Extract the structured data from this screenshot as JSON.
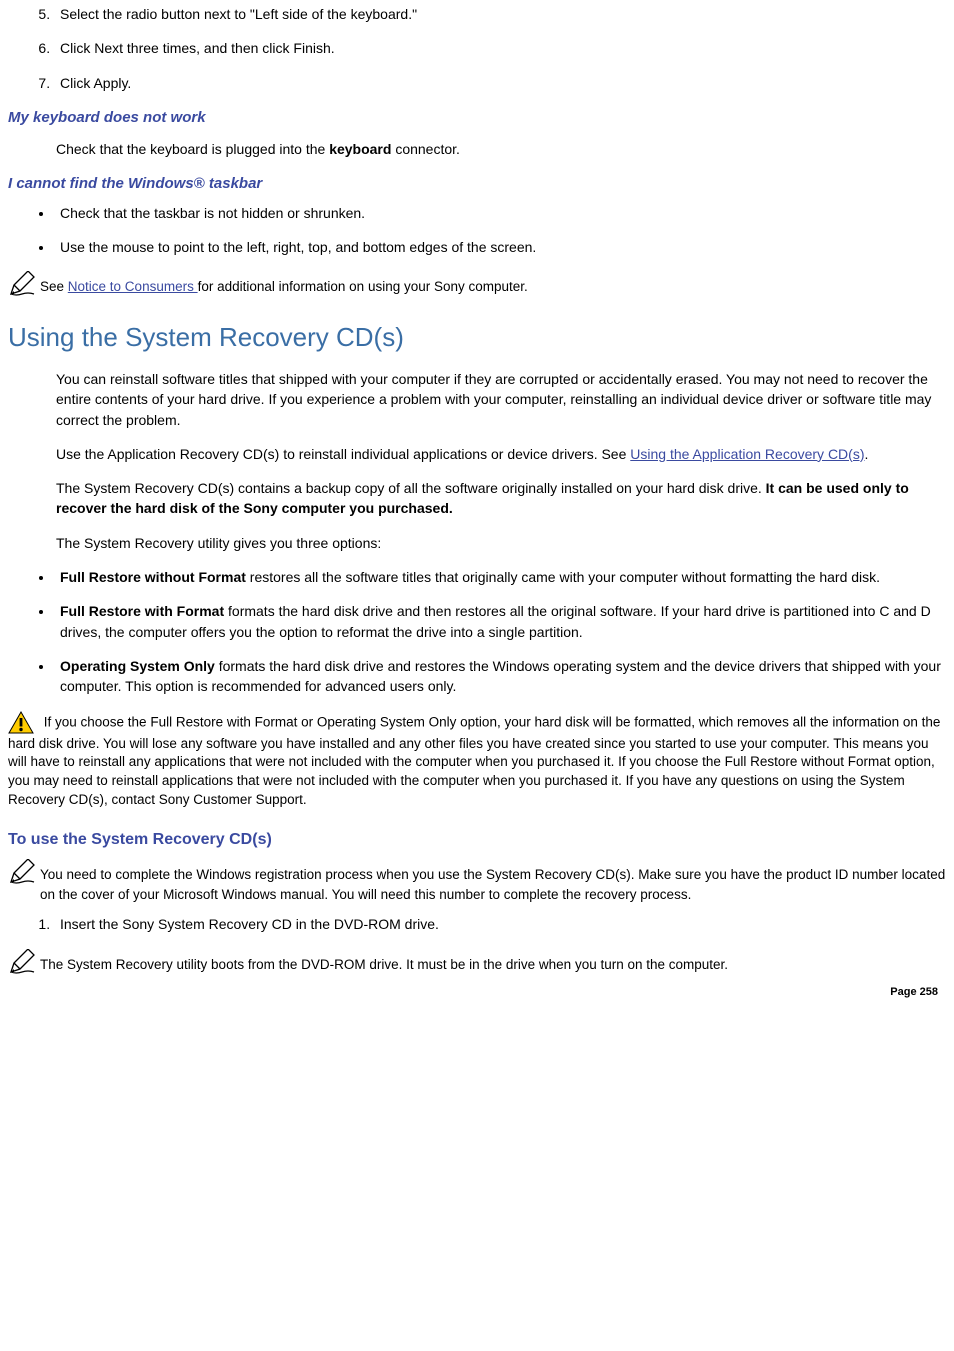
{
  "top_list": {
    "start": 5,
    "items": [
      "Select the radio button next to \"Left side of the keyboard.\"",
      "Click Next three times, and then click Finish.",
      "Click Apply."
    ]
  },
  "kb_heading": "My keyboard does not work",
  "kb_para_before": "Check that the keyboard is plugged into the ",
  "kb_para_bold": "keyboard",
  "kb_para_after": " connector.",
  "taskbar_heading": "I cannot find the Windows® taskbar",
  "taskbar_items": [
    "Check that the taskbar is not hidden or shrunken.",
    "Use the mouse to point to the left, right, top, and bottom edges of the screen."
  ],
  "note1_before": " See ",
  "note1_link": "Notice to Consumers ",
  "note1_after": "for additional information on using your Sony computer.",
  "recovery_heading": "Using the System Recovery CD(s)",
  "recovery_p1": "You can reinstall software titles that shipped with your computer if they are corrupted or accidentally erased. You may not need to recover the entire contents of your hard drive. If you experience a problem with your computer, reinstalling an individual device driver or software title may correct the problem.",
  "recovery_p2_before": "Use the Application Recovery CD(s) to reinstall individual applications or device drivers. See ",
  "recovery_p2_link": "Using the Application Recovery CD(s)",
  "recovery_p2_after": ".",
  "recovery_p3_before": "The System Recovery CD(s) contains a backup copy of all the software originally installed on your hard disk drive. ",
  "recovery_p3_bold": "It can be used only to recover the hard disk of the Sony computer you purchased.",
  "recovery_p4": "The System Recovery utility gives you three options:",
  "options": [
    {
      "bold": "Full Restore without Format",
      "rest": " restores all the software titles that originally came with your computer without formatting the hard disk."
    },
    {
      "bold": "Full Restore with Format",
      "rest": " formats the hard disk drive and then restores all the original software. If your hard drive is partitioned into C and D drives, the computer offers you the option to reformat the drive into a single partition."
    },
    {
      "bold": "Operating System Only",
      "rest": " formats the hard disk drive and restores the Windows operating system and the device drivers that shipped with your computer. This option is recommended for advanced users only."
    }
  ],
  "warning_text": " If you choose the Full Restore with Format or Operating System Only option, your hard disk will be formatted, which removes all the information on the hard disk drive. You will lose any software you have installed and any other files you have created since you started to use your computer. This means you will have to reinstall any applications that were not included with the computer when you purchased it. If you choose the Full Restore without Format option, you may need to reinstall applications that were not included with the computer when you purchased it. If you have any questions on using the System Recovery CD(s), contact Sony Customer Support.",
  "use_heading": "To use the System Recovery CD(s)",
  "note2_text": " You need to complete the Windows registration process when you use the System Recovery CD(s). Make sure you have the product ID number located on the cover of your Microsoft Windows manual. You will need this number to complete the recovery process.",
  "step1_text": "Insert the Sony System Recovery CD in the DVD-ROM drive.",
  "note3_text": " The System Recovery utility boots from the DVD-ROM drive. It must be in the drive when you turn on the computer.",
  "page_label": "Page 258"
}
